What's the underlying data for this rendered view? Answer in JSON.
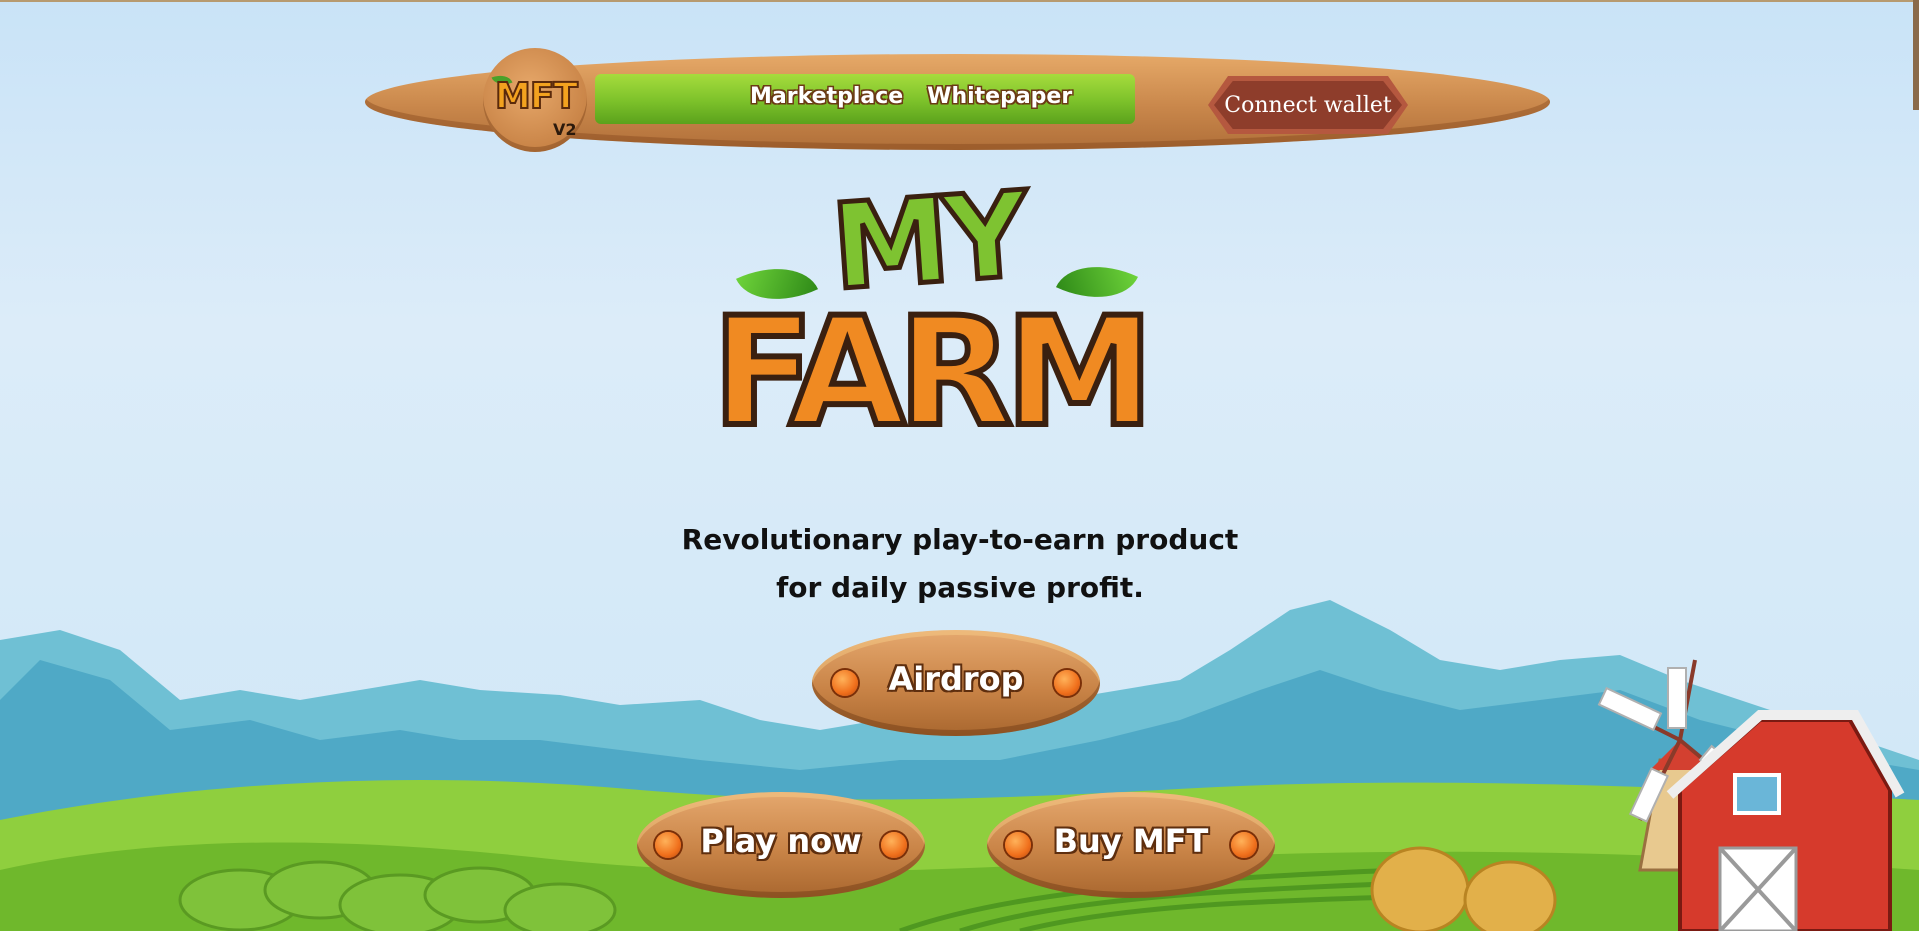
{
  "nav": {
    "logo_text": "MFT",
    "logo_version": "V2",
    "links": [
      {
        "label": "Marketplace"
      },
      {
        "label": "Whitepaper"
      }
    ],
    "connect_label": "Connect wallet"
  },
  "hero": {
    "title_line1": "MY",
    "title_line2": "FARM",
    "tagline_line1": "Revolutionary play-to-earn product",
    "tagline_line2": "for daily passive profit."
  },
  "buttons": {
    "airdrop": "Airdrop",
    "play_now": "Play now",
    "buy_mft": "Buy MFT"
  },
  "colors": {
    "wood": "#c98447",
    "nav_green": "#7cc12a",
    "connect_bg": "#8e3d2b",
    "title_green": "#7ec331",
    "title_orange": "#f08a22",
    "sky": "#d6eaf8"
  }
}
